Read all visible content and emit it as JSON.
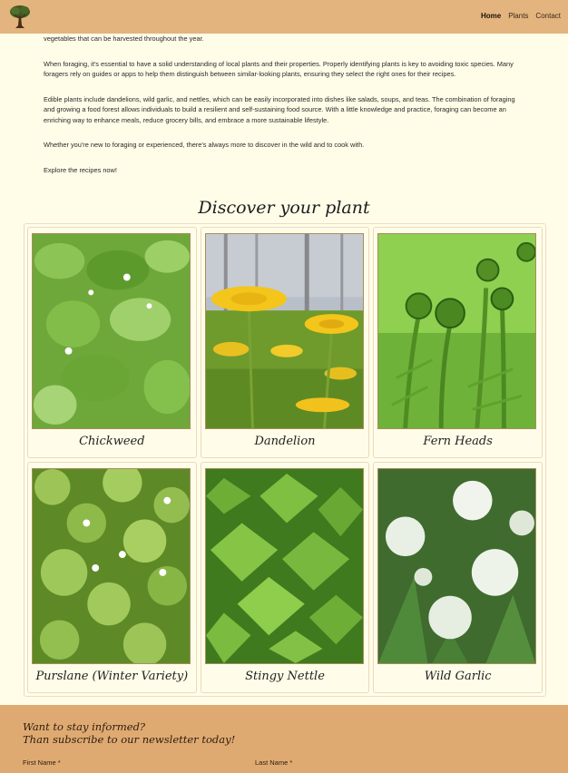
{
  "header": {
    "nav": {
      "home": "Home",
      "plants": "Plants",
      "contact": "Contact"
    }
  },
  "intro": {
    "p1": "vegetables that can be harvested throughout the year.",
    "p2": "When foraging, it's essential to have a solid understanding of local plants and their properties. Properly identifying plants is key to avoiding toxic species. Many foragers rely on guides or apps to help them distinguish between similar-looking plants, ensuring they select the right ones for their recipes.",
    "p3": "Edible plants include dandelions, wild garlic, and nettles, which can be easily incorporated into dishes like salads, soups, and teas. The combination of foraging and growing a food forest allows individuals to build a resilient and self-sustaining food source. With a little knowledge and practice, foraging can become an enriching way to enhance meals, reduce grocery bills, and embrace a more sustainable lifestyle.",
    "p4": "Whether you're new to foraging or experienced, there's always more to discover in the wild and to cook with.",
    "p5": "Explore the recipes now!"
  },
  "plants_section": {
    "title": "Discover your plant",
    "plants": [
      {
        "name": "Chickweed"
      },
      {
        "name": "Dandelion"
      },
      {
        "name": "Fern Heads"
      },
      {
        "name": "Purslane (Winter Variety)"
      },
      {
        "name": "Stingy Nettle"
      },
      {
        "name": "Wild Garlic"
      }
    ]
  },
  "newsletter": {
    "heading_line1": "Want to stay informed?",
    "heading_line2": "Than subscribe to our newsletter today!",
    "first_name_label": "First Name *",
    "last_name_label": "Last Name *"
  },
  "colors": {
    "header_bg": "#e3b47e",
    "page_bg": "#fffde8",
    "footer_bg": "#dfaa72"
  }
}
